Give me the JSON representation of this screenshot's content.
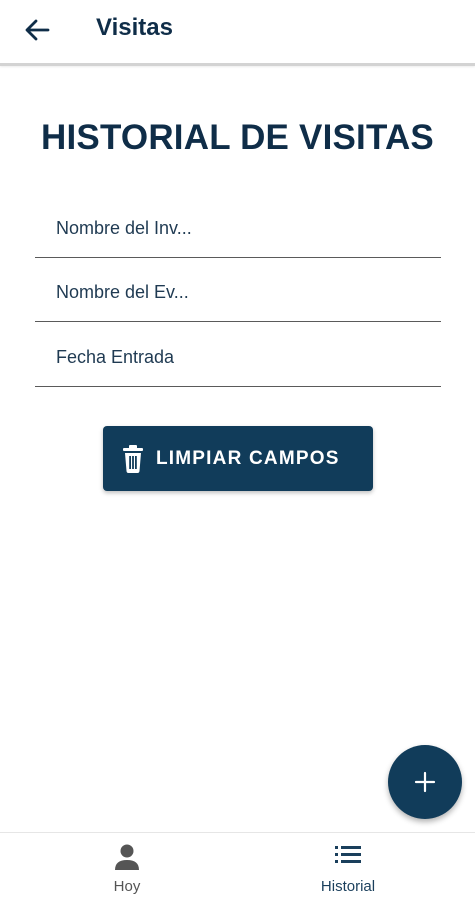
{
  "appbar": {
    "title": "Visitas",
    "back_icon": "arrow-left-icon"
  },
  "page": {
    "title": "HISTORIAL DE VISITAS"
  },
  "form": {
    "investor_name": {
      "placeholder": "Nombre del Inv...",
      "value": ""
    },
    "event_name": {
      "placeholder": "Nombre del Ev...",
      "value": ""
    },
    "entry_date": {
      "placeholder": "Fecha Entrada",
      "value": ""
    }
  },
  "actions": {
    "clear_label": "LIMPIAR CAMPOS",
    "clear_icon": "trash-icon",
    "fab_icon": "plus-icon"
  },
  "bottom_nav": {
    "items": [
      {
        "label": "Hoy",
        "icon": "person-icon",
        "active": false
      },
      {
        "label": "Historial",
        "icon": "list-icon",
        "active": true
      }
    ]
  },
  "colors": {
    "primary": "#113c5a",
    "text": "#0f2d48",
    "muted": "#555555"
  }
}
